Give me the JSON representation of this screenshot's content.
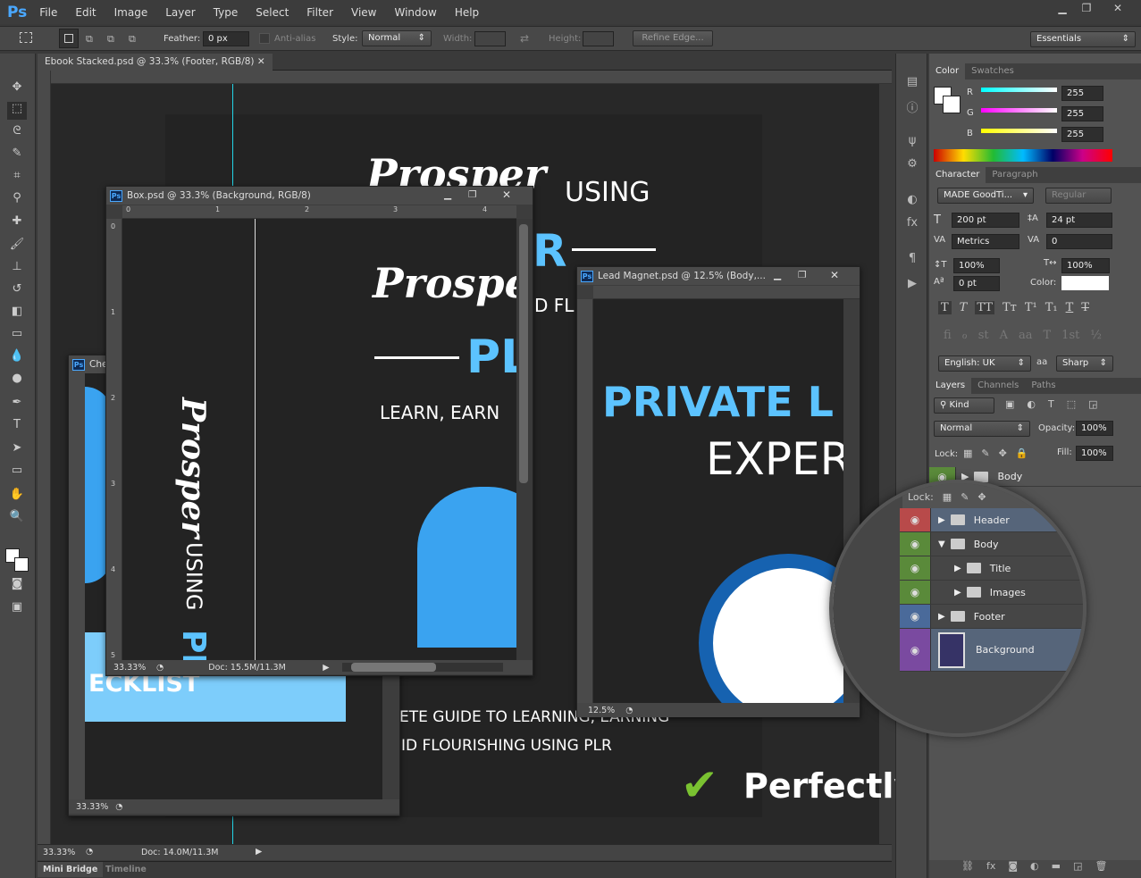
{
  "app": {
    "logo": "Ps",
    "menu": [
      "File",
      "Edit",
      "Image",
      "Layer",
      "Type",
      "Select",
      "Filter",
      "View",
      "Window",
      "Help"
    ],
    "window_controls": [
      "minimize",
      "restore",
      "close"
    ]
  },
  "options": {
    "feather_label": "Feather:",
    "feather_value": "0 px",
    "antialias_label": "Anti-alias",
    "style_label": "Style:",
    "style_value": "Normal",
    "width_label": "Width:",
    "height_label": "Height:",
    "refine_edge": "Refine Edge...",
    "workspace": "Essentials"
  },
  "main_doc": {
    "tab": "Ebook Stacked.psd @ 33.3% (Footer, RGB/8)",
    "zoom": "33.33%",
    "doc_size": "Doc: 14.0M/11.3M",
    "canvas_text": {
      "script": "Prosper",
      "using": "USING",
      "plr": "R",
      "line1": "ETE GUIDE TO LEARNING, EARNING",
      "line2": "ID FLOURISHING USING PLR"
    }
  },
  "box_doc": {
    "title": "Box.psd @ 33.3% (Background, RGB/8)",
    "zoom": "33.33%",
    "doc_size": "Doc: 15.5M/11.3M",
    "ruler_h": [
      "0",
      "1",
      "2",
      "3",
      "4"
    ],
    "ruler_v": [
      "0",
      "1",
      "2",
      "3",
      "4",
      "5"
    ],
    "text": {
      "script": "Prosper",
      "d_fl": "D FL",
      "pl": "PL",
      "learn": "LEARN, EARN",
      "vert_using": "USING",
      "vert_pl": "PL"
    }
  },
  "checklist_doc": {
    "title": "Che",
    "zoom": "33.33%",
    "text": "ECKLIST"
  },
  "lead_doc": {
    "title": "Lead Magnet.psd @ 12.5% (Body,...",
    "zoom": "12.5%",
    "text": {
      "private": "PRIVATE L",
      "exper": "EXPER"
    }
  },
  "bottom_tabs": [
    "Mini Bridge",
    "Timeline"
  ],
  "color_panel": {
    "tabs": [
      "Color",
      "Swatches"
    ],
    "channels": [
      {
        "label": "R",
        "value": "255"
      },
      {
        "label": "G",
        "value": "255"
      },
      {
        "label": "B",
        "value": "255"
      }
    ],
    "foreground": "#ffffff"
  },
  "character_panel": {
    "tabs": [
      "Character",
      "Paragraph"
    ],
    "font": "MADE GoodTi...",
    "style": "Regular",
    "size": "200 pt",
    "leading": "24 pt",
    "kerning": "Metrics",
    "tracking": "0",
    "vscale": "100%",
    "hscale": "100%",
    "baseline": "0 pt",
    "color_label": "Color:",
    "color": "#ffffff",
    "type_buttons": [
      "T",
      "T",
      "TT",
      "Tт",
      "T¹",
      "T₁",
      "T",
      "T"
    ],
    "opentype": [
      "fi",
      "ℴ",
      "st",
      "A",
      "aa",
      "T",
      "1st",
      "½"
    ],
    "language": "English: UK",
    "aa_icon": "aa",
    "antialias": "Sharp"
  },
  "layers_panel": {
    "tabs": [
      "Layers",
      "Channels",
      "Paths"
    ],
    "filter": "Kind",
    "blend": "Normal",
    "opacity_label": "Opacity:",
    "opacity": "100%",
    "lock_label": "Lock:",
    "fill_label": "Fill:",
    "fill": "100%",
    "visible_row": {
      "name": "Body"
    },
    "layers": [
      {
        "name": "Header",
        "color": "#b84a4a",
        "type": "group",
        "expanded": false,
        "indent": 0,
        "selected": true
      },
      {
        "name": "Body",
        "color": "#5a8a3a",
        "type": "group",
        "expanded": true,
        "indent": 0
      },
      {
        "name": "Title",
        "color": "#5a8a3a",
        "type": "group",
        "expanded": false,
        "indent": 1
      },
      {
        "name": "Images",
        "color": "#5a8a3a",
        "type": "group",
        "expanded": false,
        "indent": 1
      },
      {
        "name": "Footer",
        "color": "#4a6a9a",
        "type": "group",
        "expanded": false,
        "indent": 0
      },
      {
        "name": "Background",
        "color": "#7a4aa0",
        "type": "layer",
        "selected": true
      }
    ]
  },
  "caption": {
    "text": "Perfectly Layered",
    "check_color": "#7ac231"
  }
}
